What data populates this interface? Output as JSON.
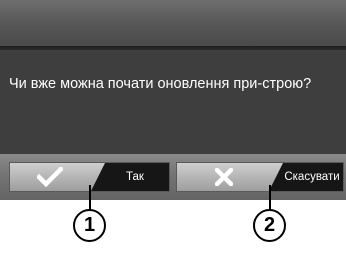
{
  "dialog": {
    "message": "Чи вже можна почати оновлення при-строю?"
  },
  "buttons": {
    "confirm": {
      "label": "Так",
      "icon": "checkmark-icon"
    },
    "cancel": {
      "label": "Скасувати",
      "icon": "cross-icon"
    }
  },
  "callouts": {
    "confirm_number": "1",
    "cancel_number": "2"
  },
  "colors": {
    "screen_background": "#3a3a3a",
    "button_face": "#b8b8b8",
    "label_tab": "#161616",
    "icon": "#ffffff",
    "text": "#ffffff"
  }
}
